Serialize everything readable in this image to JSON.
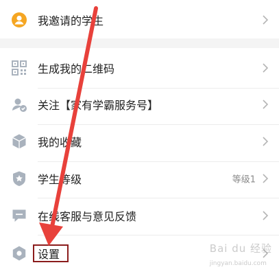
{
  "menu": {
    "items": [
      {
        "label": "我邀请的学生",
        "value": ""
      },
      {
        "label": "生成我的二维码",
        "value": ""
      },
      {
        "label": "关注【家有学霸服务号】",
        "value": ""
      },
      {
        "label": "我的收藏",
        "value": ""
      },
      {
        "label": "学生等级",
        "value": "等级1"
      },
      {
        "label": "在线客服与意见反馈",
        "value": ""
      },
      {
        "label": "设置",
        "value": ""
      }
    ]
  },
  "watermark": {
    "text": "Bai du 经验",
    "sub": "jingyan.baidu.com"
  },
  "colors": {
    "accent_orange": "#f5a623",
    "icon_gray": "#a9b2bd",
    "arrow_red": "#e8413b",
    "highlight_border": "#8b1c1c"
  },
  "icons": {
    "students": "person-icon",
    "qrcode": "qrcode-icon",
    "follow": "person-check-icon",
    "favorites": "cube-icon",
    "level": "shield-star-icon",
    "feedback": "chat-icon",
    "settings": "hexagon-settings-icon"
  }
}
